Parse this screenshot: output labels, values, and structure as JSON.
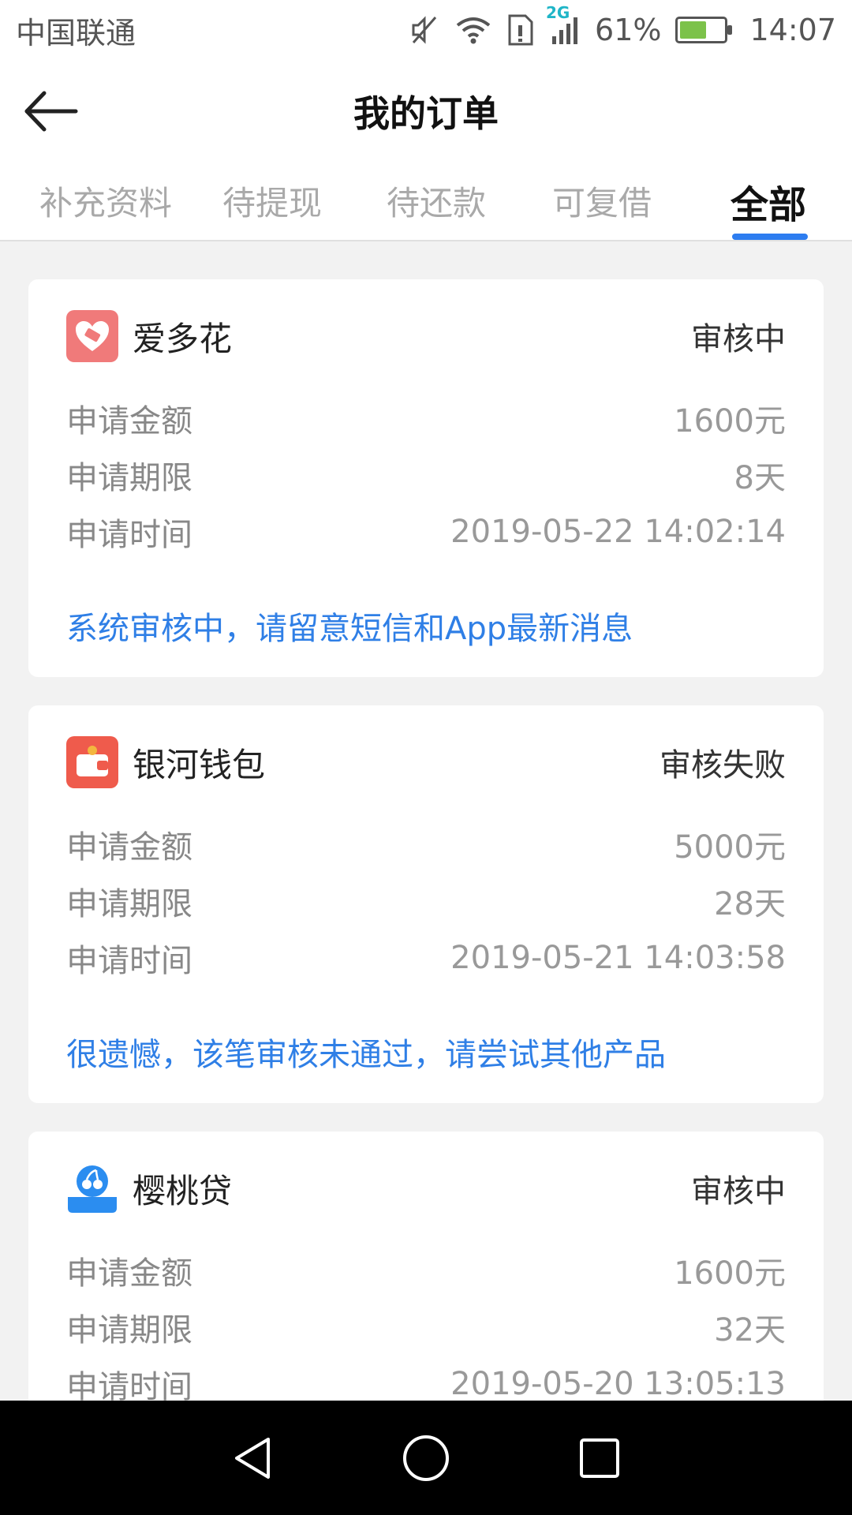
{
  "status_bar": {
    "carrier": "中国联通",
    "network_badge": "2G",
    "battery_percent": "61%",
    "time": "14:07"
  },
  "header": {
    "title": "我的订单"
  },
  "tabs": [
    {
      "label": "补充资料",
      "active": false
    },
    {
      "label": "待提现",
      "active": false
    },
    {
      "label": "待还款",
      "active": false
    },
    {
      "label": "可复借",
      "active": false
    },
    {
      "label": "全部",
      "active": true
    }
  ],
  "orders": [
    {
      "name": "爱多花",
      "status": "审核中",
      "logo_color": "#f07a7a",
      "rows": [
        {
          "label": "申请金额",
          "value": "1600元"
        },
        {
          "label": "申请期限",
          "value": "8天"
        },
        {
          "label": "申请时间",
          "value": "2019-05-22 14:02:14"
        }
      ],
      "note": "系统审核中，请留意短信和App最新消息"
    },
    {
      "name": "银河钱包",
      "status": "审核失败",
      "logo_color": "#ef5b4c",
      "rows": [
        {
          "label": "申请金额",
          "value": "5000元"
        },
        {
          "label": "申请期限",
          "value": "28天"
        },
        {
          "label": "申请时间",
          "value": "2019-05-21 14:03:58"
        }
      ],
      "note": "很遗憾，该笔审核未通过，请尝试其他产品"
    },
    {
      "name": "樱桃贷",
      "status": "审核中",
      "logo_color": "#2b8df0",
      "rows": [
        {
          "label": "申请金额",
          "value": "1600元"
        },
        {
          "label": "申请期限",
          "value": "32天"
        },
        {
          "label": "申请时间",
          "value": "2019-05-20 13:05:13"
        }
      ],
      "note": ""
    }
  ],
  "accent_color": "#2d7df0"
}
